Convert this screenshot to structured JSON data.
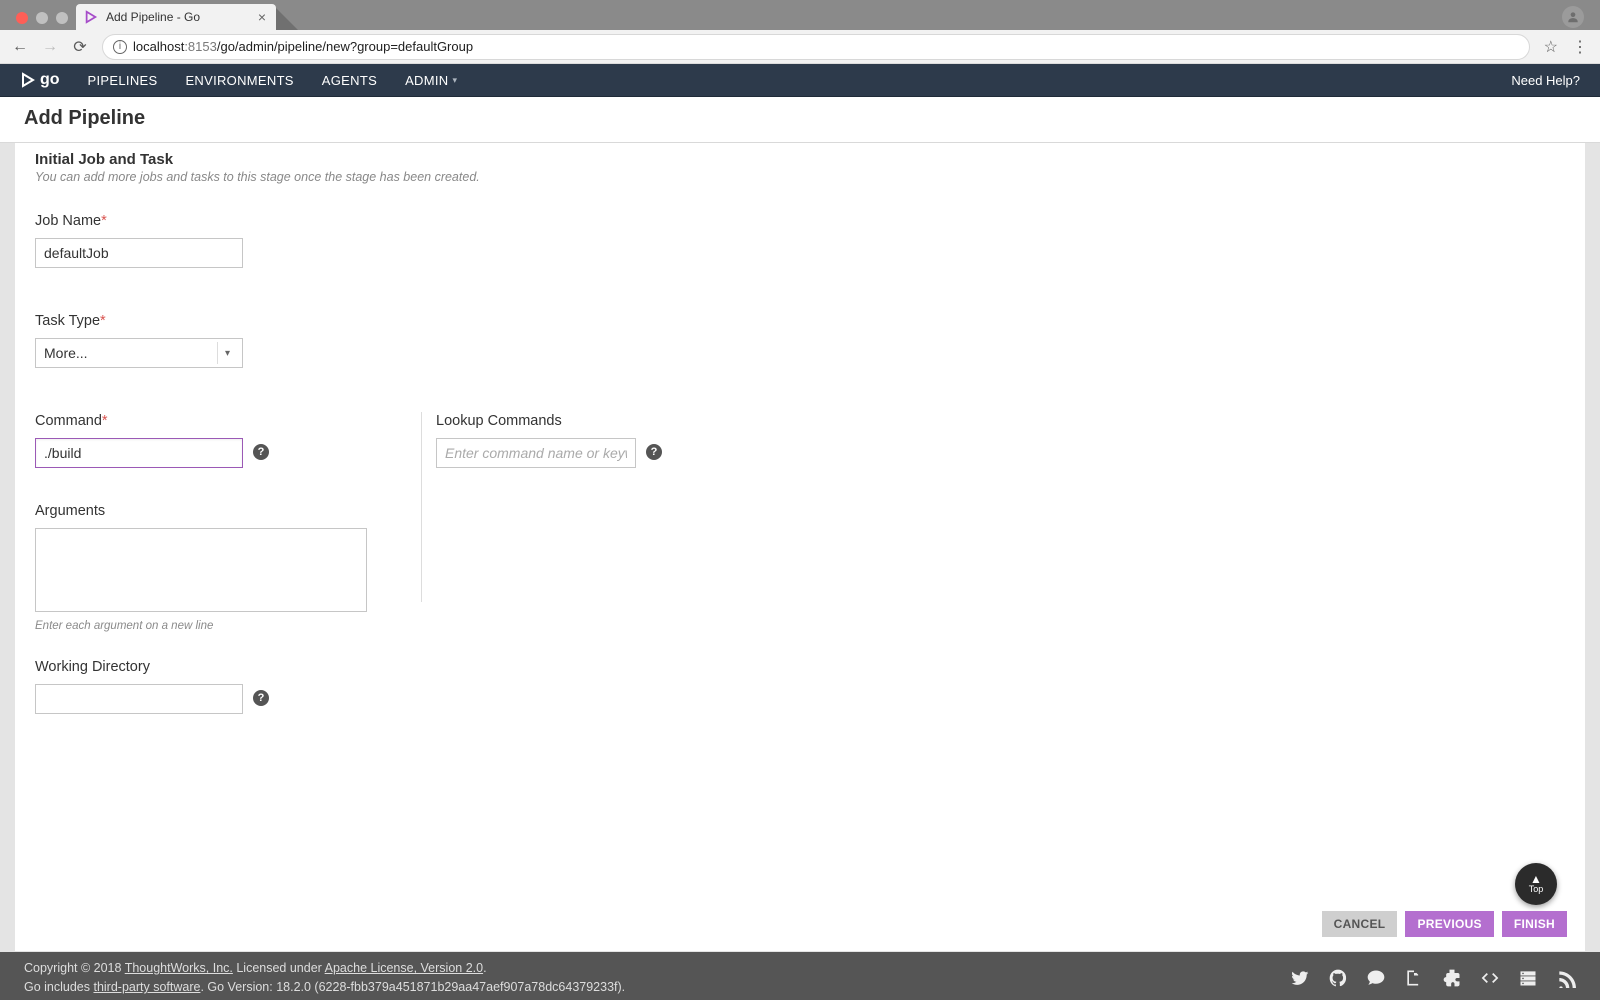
{
  "browser": {
    "tab_title": "Add Pipeline - Go",
    "url_host": "localhost",
    "url_port": ":8153",
    "url_path": "/go/admin/pipeline/new?group=defaultGroup"
  },
  "nav": {
    "logo": "go",
    "items": [
      "PIPELINES",
      "ENVIRONMENTS",
      "AGENTS",
      "ADMIN"
    ],
    "help": "Need Help?"
  },
  "page": {
    "title": "Add Pipeline",
    "section_title": "Initial Job and Task",
    "section_sub": "You can add more jobs and tasks to this stage once the stage has been created."
  },
  "form": {
    "job_name_label": "Job Name",
    "job_name_value": "defaultJob",
    "task_type_label": "Task Type",
    "task_type_value": "More...",
    "command_label": "Command",
    "command_value": "./build",
    "lookup_label": "Lookup Commands",
    "lookup_placeholder": "Enter command name or keyword",
    "arguments_label": "Arguments",
    "arguments_value": "",
    "arguments_hint": "Enter each argument on a new line",
    "workdir_label": "Working Directory",
    "workdir_value": ""
  },
  "buttons": {
    "cancel": "CANCEL",
    "previous": "PREVIOUS",
    "finish": "FINISH",
    "top": "Top"
  },
  "footer": {
    "line1_a": "Copyright © 2018 ",
    "line1_link1": "ThoughtWorks, Inc.",
    "line1_b": " Licensed under ",
    "line1_link2": "Apache License, Version 2.0",
    "line1_c": ".",
    "line2_a": "Go includes ",
    "line2_link": "third-party software",
    "line2_b": ". Go Version: 18.2.0 (6228-fbb379a451871b29aa47aef907a78dc64379233f)."
  },
  "icons": {
    "twitter": "twitter-icon",
    "github": "github-icon",
    "chat": "chat-icon",
    "docs": "docs-icon",
    "plugins": "plugins-icon",
    "api": "api-icon",
    "server": "server-icon",
    "rss": "rss-icon"
  }
}
